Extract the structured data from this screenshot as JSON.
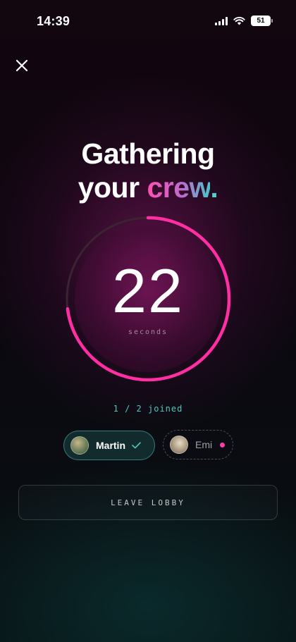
{
  "status_bar": {
    "time": "14:39",
    "battery": "51",
    "icons": [
      "signal-icon",
      "wifi-icon",
      "battery-icon"
    ]
  },
  "close": {
    "icon": "close-icon"
  },
  "headline": {
    "line1": "Gathering",
    "line2_prefix": "your ",
    "line2_accent": "crew",
    "line2_suffix": "."
  },
  "timer": {
    "value": "22",
    "unit": "seconds",
    "progress_fraction": 0.73,
    "ring_color": "#ff2fa3",
    "track_color": "#3a2530"
  },
  "lobby": {
    "joined_text": "1 / 2 joined",
    "players": [
      {
        "name": "Martin",
        "status": "joined",
        "status_icon": "check-icon"
      },
      {
        "name": "Emi",
        "status": "pending",
        "status_icon": "pending-dot"
      }
    ]
  },
  "actions": {
    "leave_label": "LEAVE LOBBY"
  },
  "colors": {
    "accent_pink": "#ff2fa3",
    "accent_teal": "#52c7bf"
  }
}
